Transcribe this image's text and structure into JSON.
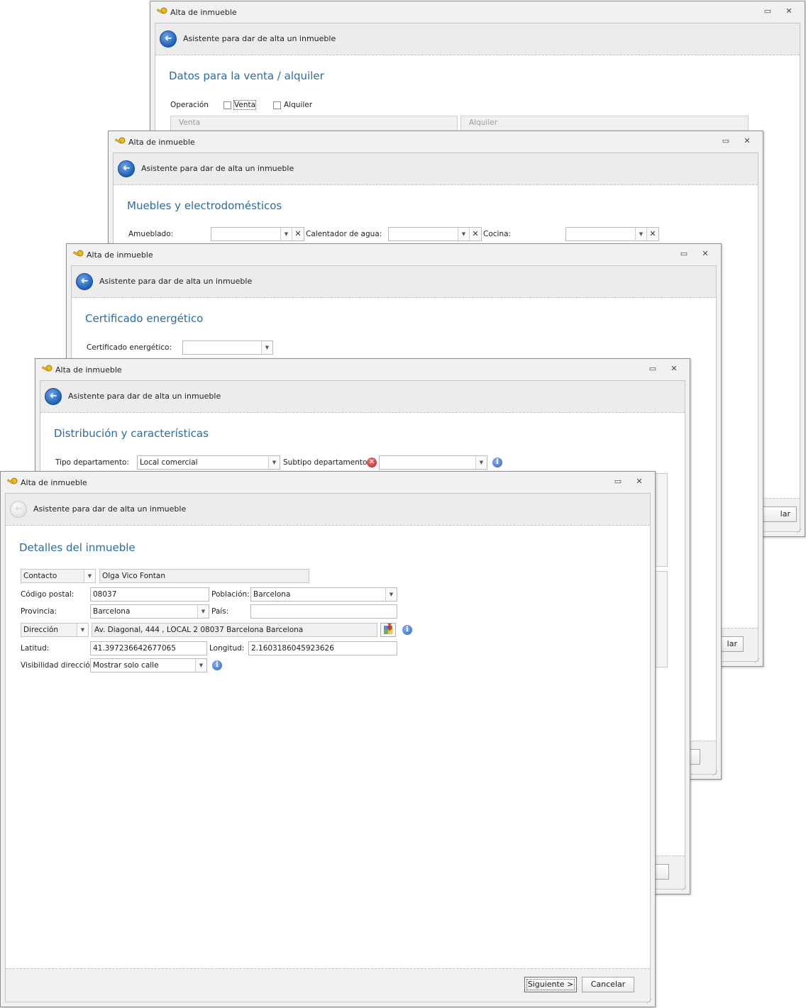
{
  "window_title": "Alta de inmueble",
  "wizard_title": "Asistente para dar de alta un inmueble",
  "icons": {
    "title": "key-icon",
    "restore": "restore-icon",
    "close": "close-icon",
    "back": "back-arrow-icon",
    "info": "info-icon",
    "error": "error-icon",
    "map": "map-icon"
  },
  "glyphs": {
    "restore": "▭",
    "close": "✕",
    "back": "➜",
    "drop": "▼",
    "clear": "✕",
    "info": "i",
    "err": "✕",
    "grip": "⋰"
  },
  "win1": {
    "section": "Datos para la venta / alquiler",
    "operacion_label": "Operación",
    "venta_label": "Venta",
    "alquiler_label": "Alquiler",
    "venta_placeholder": "Venta",
    "alquiler_placeholder": "Alquiler",
    "cancel_partial": "lar"
  },
  "win2": {
    "section": "Muebles y electrodomésticos",
    "amueblado_label": "Amueblado:",
    "calentador_label": "Calentador de agua:",
    "cocina_label": "Cocina:",
    "cancel_partial": "lar"
  },
  "win3": {
    "section": "Certificado energético",
    "certificado_label": "Certificado energético:"
  },
  "win4": {
    "section": "Distribución y características",
    "tipo_label": "Tipo departamento:",
    "tipo_value": "Local comercial",
    "subtipo_label": "Subtipo departamento:"
  },
  "win5": {
    "section": "Detalles del inmueble",
    "contacto_type": "Contacto",
    "contacto_value": "Olga Vico Fontan",
    "cp_label": "Código postal:",
    "cp_value": "08037",
    "poblacion_label": "Población:",
    "poblacion_value": "Barcelona",
    "provincia_label": "Provincia:",
    "provincia_value": "Barcelona",
    "pais_label": "País:",
    "pais_value": "",
    "direccion_type": "Dirección",
    "direccion_value": "Av. Diagonal, 444 , LOCAL 2 08037 Barcelona Barcelona",
    "latitud_label": "Latitud:",
    "latitud_value": "41.397236642677065",
    "longitud_label": "Longitud:",
    "longitud_value": "2.1603186045923626",
    "visibilidad_label": "Visibilidad dirección:",
    "visibilidad_value": "Mostrar solo calle",
    "next_button": "Siguiente >",
    "cancel_button": "Cancelar"
  }
}
